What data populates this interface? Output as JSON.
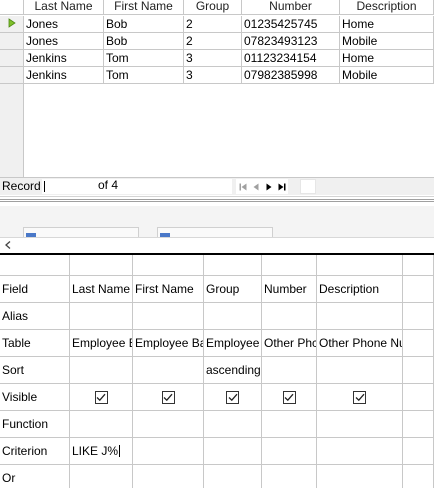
{
  "results": {
    "columns": [
      "Last Name",
      "First Name",
      "Group",
      "Number",
      "Description"
    ],
    "rows": [
      [
        "Jones",
        "Bob",
        "2",
        "01235425745",
        "Home"
      ],
      [
        "Jones",
        "Bob",
        "2",
        "07823493123",
        "Mobile"
      ],
      [
        "Jenkins",
        "Tom",
        "3",
        "01123234154",
        "Home"
      ],
      [
        "Jenkins",
        "Tom",
        "3",
        "07982385998",
        "Mobile"
      ]
    ],
    "current_row_icon": "current-record-arrow-icon"
  },
  "navigator": {
    "record_label": "Record",
    "record_value": "",
    "of_text": "of 4",
    "buttons": [
      "first-record-icon",
      "previous-record-icon",
      "next-record-icon",
      "last-record-icon"
    ]
  },
  "design": {
    "row_labels": {
      "field": "Field",
      "alias": "Alias",
      "table": "Table",
      "sort": "Sort",
      "visible": "Visible",
      "function": "Function",
      "criterion": "Criterion",
      "or": "Or"
    },
    "columns": [
      {
        "field": "Last Name",
        "alias": "",
        "table": "Employee B",
        "sort": "",
        "visible": true,
        "function": "",
        "criterion": "LIKE J%"
      },
      {
        "field": "First Name",
        "alias": "",
        "table": "Employee Ba",
        "sort": "",
        "visible": true,
        "function": "",
        "criterion": ""
      },
      {
        "field": "Group",
        "alias": "",
        "table": "Employee",
        "sort": "ascending",
        "visible": true,
        "function": "",
        "criterion": ""
      },
      {
        "field": "Number",
        "alias": "",
        "table": "Other Phc",
        "sort": "",
        "visible": true,
        "function": "",
        "criterion": ""
      },
      {
        "field": "Description",
        "alias": "",
        "table": "Other Phone Nu",
        "sort": "",
        "visible": true,
        "function": "",
        "criterion": ""
      }
    ]
  },
  "colors": {
    "current_arrow": "#7fbf2a",
    "table_window_accent": "#4a78c8",
    "grid_line": "#c8c8c8"
  }
}
